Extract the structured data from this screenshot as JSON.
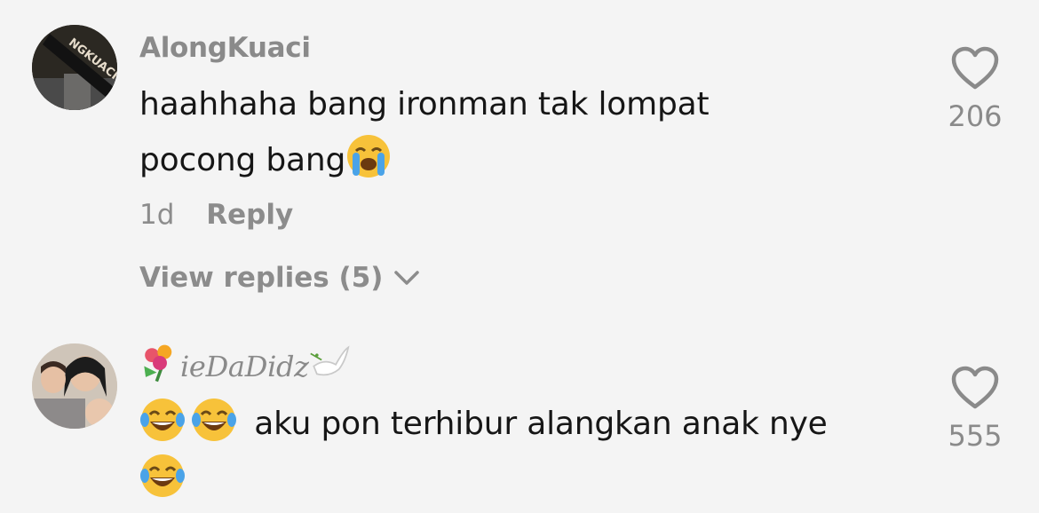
{
  "comments": [
    {
      "username": "AlongKuaci",
      "avatar_text": "NGKUACI",
      "text_line1": "haahhaha bang ironman tak lompat",
      "text_line2": "pocong bang",
      "time": "1d",
      "reply_label": "Reply",
      "view_replies": "View replies (5)",
      "likes": "206"
    },
    {
      "username": "ieDaDidz",
      "text": "aku pon terhibur alangkan anak nye",
      "likes": "555"
    }
  ],
  "colors": {
    "background": "#f4f4f4",
    "text": "#161616",
    "muted": "#8a8a8a"
  },
  "icons": [
    "heart-icon",
    "chevron-down-icon",
    "crying-face-emoji",
    "tears-of-joy-emoji",
    "flower-bouquet-emoji",
    "dove-emoji"
  ]
}
